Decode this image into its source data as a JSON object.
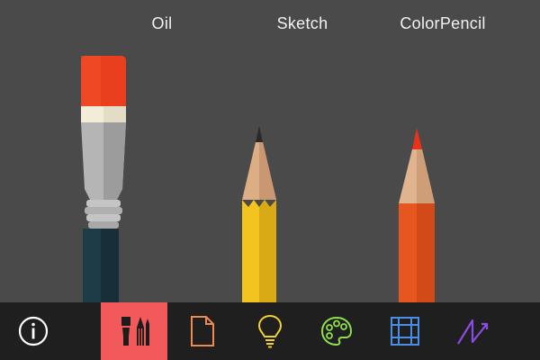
{
  "brushes": [
    {
      "name": "Oil"
    },
    {
      "name": "Sketch"
    },
    {
      "name": "ColorPencil"
    }
  ],
  "toolbar": {
    "items": [
      {
        "icon": "info-icon",
        "active": false
      },
      {
        "icon": "brushes-icon",
        "active": true
      },
      {
        "icon": "document-icon",
        "active": false
      },
      {
        "icon": "lightbulb-icon",
        "active": false
      },
      {
        "icon": "palette-icon",
        "active": false
      },
      {
        "icon": "grid-icon",
        "active": false
      },
      {
        "icon": "zigzag-icon",
        "active": false
      }
    ]
  },
  "colors": {
    "background": "#4a4a4a",
    "toolbar": "#1f1f1f",
    "active_tab": "#f2595a",
    "oil_tip": "#e93f1e",
    "pencil_body": "#f3c31f",
    "colorpencil_body": "#e8561f"
  }
}
